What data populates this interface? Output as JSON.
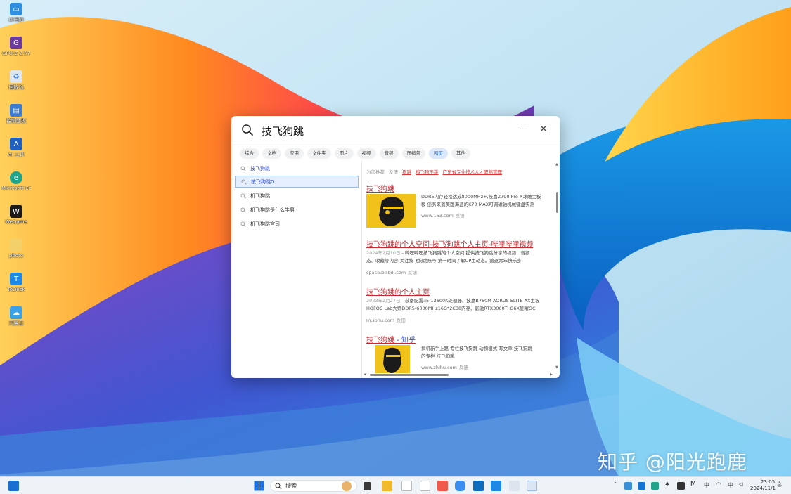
{
  "desktop": {
    "icons": [
      {
        "label": "此电脑",
        "color": "#2f8fe0",
        "icon": "computer-icon"
      },
      {
        "label": "GPU-Z 2.57",
        "color": "#6a3b9c",
        "icon": "gpuz-icon"
      },
      {
        "label": "回收站",
        "color": "#dfe7ee",
        "icon": "recycle-bin-icon"
      },
      {
        "label": "控制面板",
        "color": "#3b7cd0",
        "icon": "control-panel-icon"
      },
      {
        "label": "AI 工具",
        "color": "#1f5fbf",
        "icon": "ai-icon"
      },
      {
        "label": "Microsoft Edge",
        "color": "#1fa38a",
        "icon": "edge-icon"
      },
      {
        "label": "WeGame",
        "color": "#1b1b1b",
        "icon": "wegame-icon"
      },
      {
        "label": "photo",
        "color": "#f3d06a",
        "icon": "folder-icon"
      },
      {
        "label": "ToDesk",
        "color": "#1e88e5",
        "icon": "todesk-icon"
      },
      {
        "label": "天翼云",
        "color": "#3aa0e8",
        "icon": "cloud-icon"
      }
    ]
  },
  "watermark": "知乎 @阳光跑鹿",
  "search_window": {
    "query": "技飞狗跳",
    "tabs": [
      "综合",
      "文档",
      "应用",
      "文件夹",
      "图片",
      "视频",
      "音频",
      "压缩包",
      "网页",
      "其他"
    ],
    "active_tab": "网页",
    "suggestions": [
      "技飞狗跳",
      "技飞狗跳0",
      "机飞狗跳",
      "机飞狗跳是什么牛男",
      "机飞狗跳官司"
    ],
    "right": {
      "top_line": {
        "label": "为您推荐",
        "feedback": "反馈",
        "links": [
          "狗跳",
          "鸡飞狗不跳",
          "广东省专业技术人才职称管理"
        ]
      },
      "results": [
        {
          "title": "技飞狗跳",
          "snippet_lines": [
            "DDR5内存轻松达成8000MHz+,技嘉Z790 Pro X冰雕主板",
            "移 债务来到美国海盗的K70 MAX可调磁轴机械键盘实测"
          ],
          "source": "www.163.com",
          "feedback": "反馈"
        },
        {
          "title": "技飞狗跳的个人空间-技飞狗跳个人主页-哔哩哔哩视频",
          "date": "2024年2月10日",
          "snippet_lines": [
            "- 哔哩哔哩技飞狗跳的个人空间,提供技飞狗跳分享的视频、音频",
            "态、收藏等内容,关注技飞狗跳账号,第一时间了解UP主动态。追逐青年快乐多"
          ],
          "source": "space.bilibili.com",
          "feedback": "反馈"
        },
        {
          "title": "技飞狗跳的个人主页",
          "date": "2023年2月27日",
          "snippet_lines": [
            "- 装备配置:i5-13600K处理器、技嘉B760M AORUS ELITE AX主板",
            "HOFOC Lab大师DDR5-6000MHz16G*2C38内存、影驰RTX3060Ti G6X星曜OC"
          ],
          "source": "m.sohu.com",
          "feedback": "反馈"
        },
        {
          "title": "技飞狗跳",
          "title_suffix": " - 知乎",
          "snippet_lines": [
            "搞机新手上路 专栏技飞狗跳 动物模式 写文章 技飞狗跳",
            "的专栏 技飞狗跳"
          ],
          "source": "www.zhihu.com",
          "feedback": "反馈"
        }
      ]
    }
  },
  "taskbar": {
    "search_placeholder": "搜索",
    "tray": {
      "ime": "中",
      "time": "23:05",
      "date": "2024/11/1"
    }
  }
}
